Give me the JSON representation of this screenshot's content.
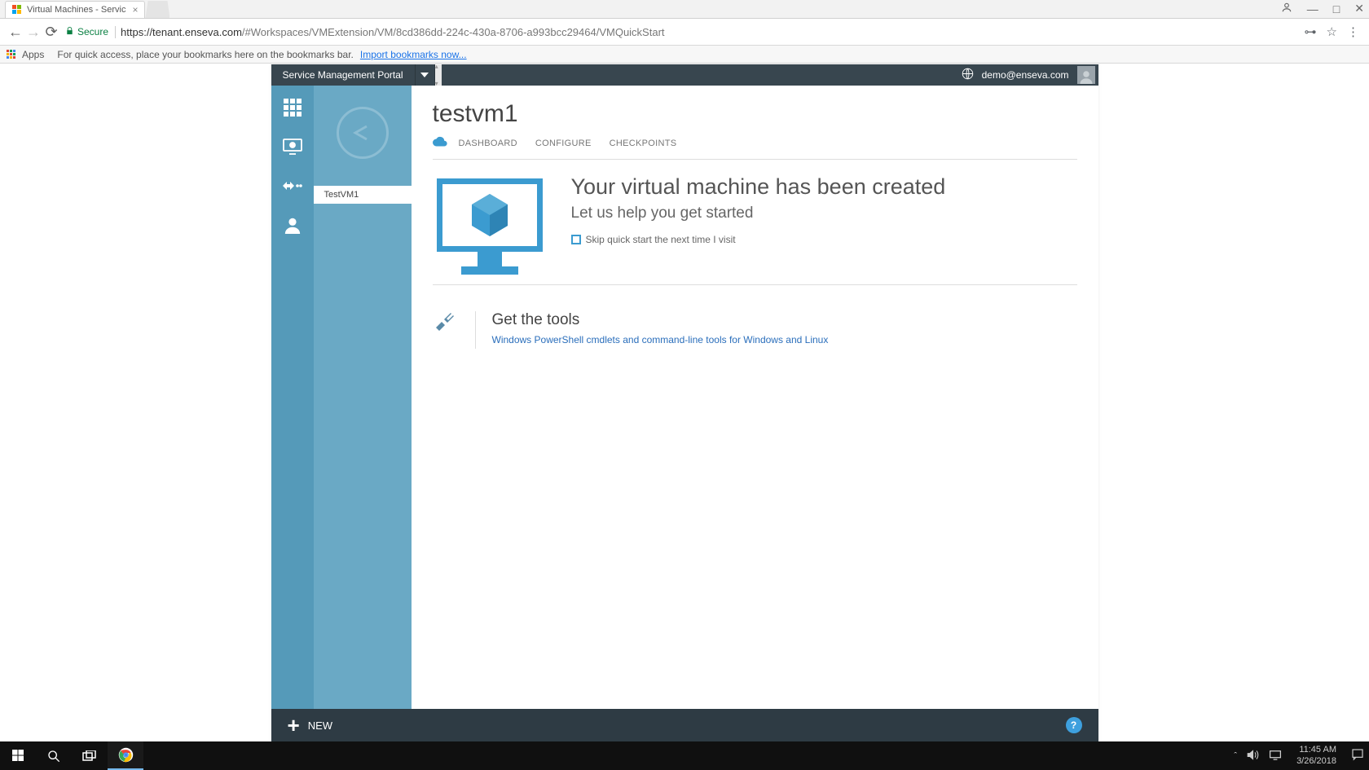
{
  "browser": {
    "tab_title": "Virtual Machines - Servic",
    "secure_label": "Secure",
    "url_host": "https://tenant.enseva.com",
    "url_path": "/#Workspaces/VMExtension/VM/8cd386dd-224c-430a-8706-a993bcc29464/VMQuickStart",
    "apps_label": "Apps",
    "bookmark_text": "For quick access, place your bookmarks here on the bookmarks bar.",
    "bookmark_link": "Import bookmarks now..."
  },
  "portal": {
    "header_title": "Service Management Portal",
    "user_email": "demo@enseva.com",
    "subnav_item": "TestVM1",
    "page_title": "testvm1",
    "tabs": {
      "dashboard": "DASHBOARD",
      "configure": "CONFIGURE",
      "checkpoints": "CHECKPOINTS"
    },
    "qs_heading": "Your virtual machine has been created",
    "qs_sub": "Let us help you get started",
    "qs_skip": "Skip quick start the next time I visit",
    "tools_heading": "Get the tools",
    "tools_link": "Windows PowerShell cmdlets and command-line tools for Windows and Linux",
    "footer_new": "NEW"
  },
  "taskbar": {
    "time": "11:45 AM",
    "date": "3/26/2018"
  }
}
